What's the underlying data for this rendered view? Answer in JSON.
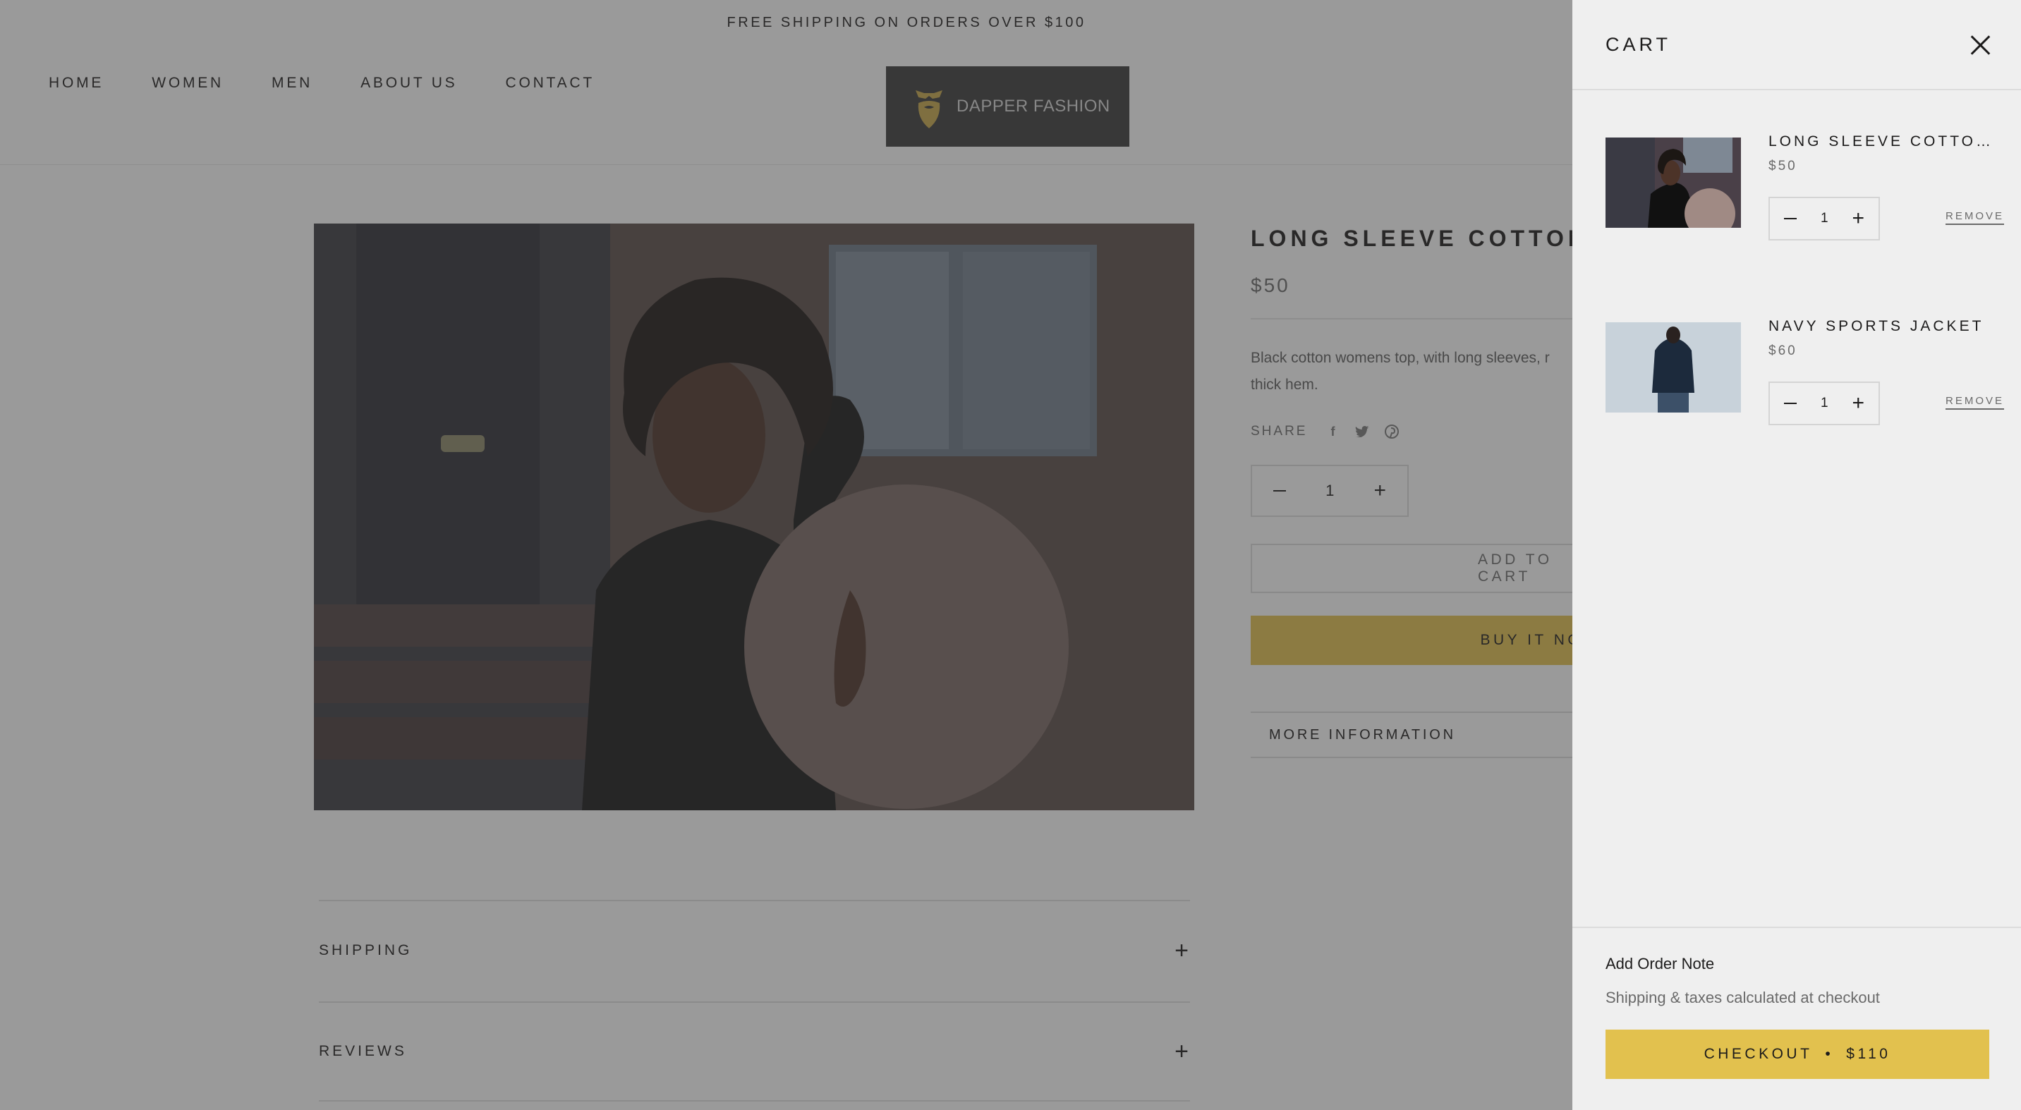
{
  "announcement": "FREE SHIPPING ON ORDERS OVER $100",
  "nav": [
    "HOME",
    "WOMEN",
    "MEN",
    "ABOUT US",
    "CONTACT"
  ],
  "logo": {
    "text": "DAPPER FASHION"
  },
  "product": {
    "title": "LONG SLEEVE COTTON",
    "price": "$50",
    "description": "Black cotton womens top, with long sleeves, r thick hem.",
    "share_label": "SHARE",
    "share_icons": [
      "facebook-icon",
      "twitter-icon",
      "pinterest-icon"
    ],
    "quantity": "1",
    "add_to_cart": "ADD TO CART",
    "buy_now": "BUY IT NOW",
    "more_info": "MORE INFORMATION"
  },
  "accordions": [
    "SHIPPING",
    "REVIEWS"
  ],
  "cart": {
    "title": "CART",
    "items": [
      {
        "name": "LONG SLEEVE COTTON TOP",
        "price": "$50",
        "qty": "1",
        "remove": "REMOVE"
      },
      {
        "name": "NAVY SPORTS JACKET",
        "price": "$60",
        "qty": "1",
        "remove": "REMOVE"
      }
    ],
    "order_note": "Add Order Note",
    "tax_note": "Shipping & taxes calculated at checkout",
    "checkout_label": "CHECKOUT",
    "checkout_separator": "•",
    "checkout_total": "$110"
  },
  "colors": {
    "accent": "#e2c14e",
    "overlay": "rgba(54,54,54,0.5)",
    "drawer_bg": "#efefef"
  }
}
